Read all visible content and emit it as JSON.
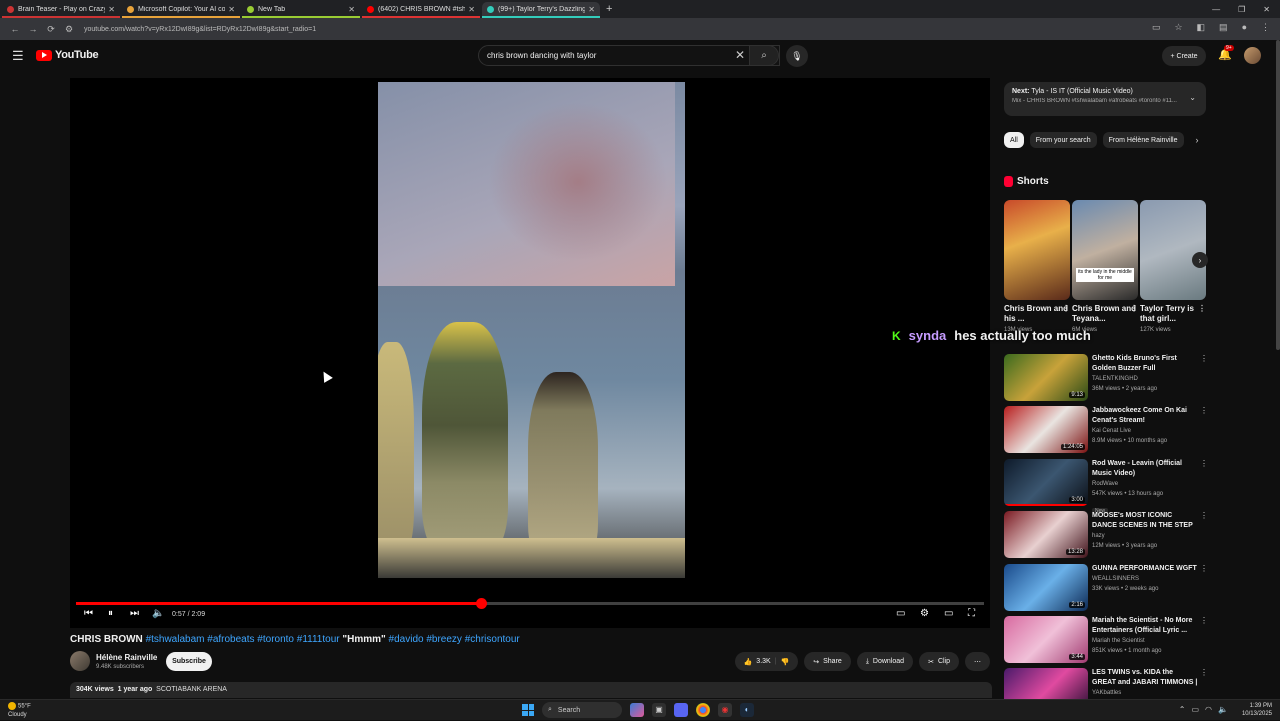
{
  "browser": {
    "tabs": [
      {
        "label": "Brain Teaser - Play on CrazyGa...",
        "fav": "#c33"
      },
      {
        "label": "Microsoft Copilot: Your AI com...",
        "fav": "#e8a33a"
      },
      {
        "label": "New Tab",
        "fav": "#9c3"
      },
      {
        "label": "(6402) CHRIS BROWN #tshw...",
        "fav": "#f00"
      },
      {
        "label": "(99+) Taylor Terry's Dazzling Da...",
        "fav": "#3cb"
      }
    ],
    "url": "youtube.com/watch?v=yRx12DwI89g&list=RDyRx12DwI89g&start_radio=1"
  },
  "header": {
    "logo": "YouTube",
    "search_value": "chris brown dancing with taylor",
    "create_label": "Create",
    "notif_count": "9+"
  },
  "player": {
    "time": "0:57 / 2:09",
    "progress": 0.446
  },
  "video": {
    "title_main": "CHRIS BROWN",
    "title_tags": "#tshwalabam #afrobeats #toronto #1111tour",
    "title_quote": "\"Hmmm\"",
    "title_tags2": "#davido #breezy #chrisontour",
    "channel": "Hélène Rainville",
    "subs": "9.48K subscribers",
    "subscribe": "Subscribe",
    "likes": "3.3K",
    "share": "Share",
    "download": "Download",
    "clip": "Clip",
    "views": "304K views",
    "age": "1 year ago",
    "location": "SCOTIABANK ARENA"
  },
  "sidebar": {
    "next_label": "Next:",
    "next_title": "Tyla - IS IT (Official Music Video)",
    "next_sub": "Mix - CHRIS BROWN #tshwalabam #afrobeats #toronto #11...",
    "chips": [
      "All",
      "From your search",
      "From Hélène Rainville"
    ],
    "shorts_title": "Shorts",
    "shorts": [
      {
        "title": "Chris Brown and his ...",
        "views": "13M views",
        "cap": ""
      },
      {
        "title": "Chris Brown and Teyana...",
        "views": "6M views",
        "cap": "its the lady in the middle for me"
      },
      {
        "title": "Taylor Terry is that girl...",
        "views": "127K views",
        "cap": ""
      }
    ],
    "videos": [
      {
        "title": "Ghetto Kids Bruno's First Golden Buzzer Full Performance | ...",
        "channel": "TALENTKINGHD",
        "stats": "36M views • 2 years ago",
        "dur": "9:13",
        "bg": "linear-gradient(135deg,#3a6a1e,#c8a23a,#2a4a16)"
      },
      {
        "title": "Jabbawockeez Come On Kai Cenat's Stream!",
        "channel": "Kai Cenat Live",
        "stats": "8.9M views • 10 months ago",
        "dur": "1:24:05",
        "bg": "linear-gradient(135deg,#b81d1d,#e9e4e0,#7b1111)"
      },
      {
        "title": "Rod Wave - Leavin (Official Music Video)",
        "channel": "RodWave",
        "stats": "547K views • 13 hours ago",
        "dur": "3:00",
        "bg": "linear-gradient(135deg,#0e1a2a,#3b5670,#0b0f16)",
        "new": "New"
      },
      {
        "title": "MOOSE's MOST ICONIC DANCE SCENES IN THE STEP UP ...",
        "channel": "hazy",
        "stats": "12M views • 3 years ago",
        "dur": "13:28",
        "bg": "linear-gradient(135deg,#7a1a22,#e8d0d0,#40121a)"
      },
      {
        "title": "GUNNA PERFORMANCE WGFT",
        "channel": "WEALLSINNERS",
        "stats": "33K views • 2 weeks ago",
        "dur": "2:16",
        "bg": "linear-gradient(135deg,#1a4a8a,#6ab0e8,#0d2a55)"
      },
      {
        "title": "Mariah the Scientist - No More Entertainers (Official Lyric ...",
        "channel": "Mariah the Scientist",
        "stats": "851K views • 1 month ago",
        "dur": "3:44",
        "bg": "linear-gradient(135deg,#d86aa0,#f0c0d8,#a03a70)"
      },
      {
        "title": "LES TWINS vs. KIDA the GREAT and JABARI TIMMONS | ...",
        "channel": "YAKbattles",
        "stats": "",
        "dur": "",
        "bg": "linear-gradient(135deg,#4a1a6a,#e04aa0,#1a0a2a)"
      }
    ]
  },
  "overlay": {
    "user": "synda",
    "message": "hes actually too much"
  },
  "taskbar": {
    "temp": "55°F",
    "weather": "Cloudy",
    "search": "Search",
    "time": "1:39 PM",
    "date": "10/13/2025"
  }
}
